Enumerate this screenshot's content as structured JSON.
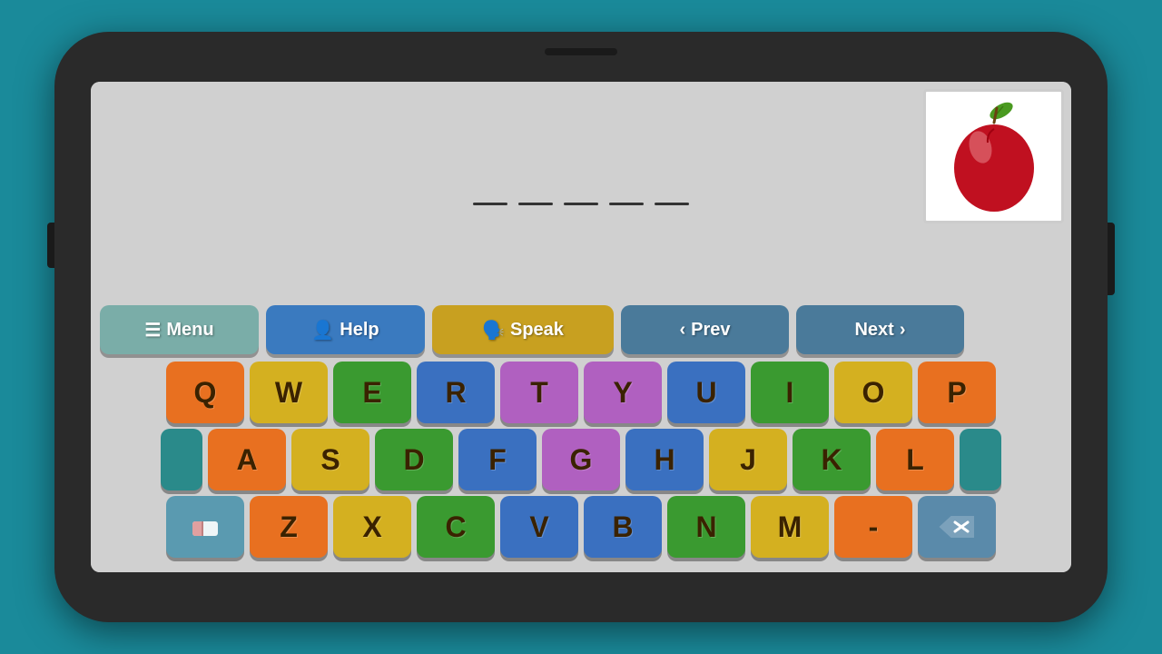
{
  "phone": {
    "background": "#1a8a9a"
  },
  "nav": {
    "menu_label": "Menu",
    "help_label": "Help",
    "speak_label": "Speak",
    "prev_label": "Prev",
    "next_label": "Next",
    "menu_icon": "☰",
    "help_icon": "👤",
    "speak_icon": "🗣️",
    "prev_arrow": "‹",
    "next_arrow": "›"
  },
  "word_blanks": {
    "count": 5
  },
  "keyboard": {
    "row1": [
      "Q",
      "W",
      "E",
      "R",
      "T",
      "Y",
      "U",
      "I",
      "O",
      "P"
    ],
    "row2": [
      "A",
      "S",
      "D",
      "F",
      "G",
      "H",
      "J",
      "K",
      "L"
    ],
    "row3": [
      "Z",
      "X",
      "C",
      "V",
      "B",
      "N",
      "M",
      "-"
    ],
    "row1_colors": [
      "orange",
      "yellow",
      "green",
      "blue",
      "purple",
      "purple",
      "blue",
      "green",
      "yellow",
      "orange"
    ],
    "row2_colors": [
      "orange",
      "yellow",
      "green",
      "blue",
      "purple",
      "blue",
      "yellow",
      "green",
      "orange"
    ],
    "row3_colors": [
      "orange",
      "yellow",
      "green",
      "blue",
      "blue",
      "green",
      "yellow",
      "orange"
    ]
  },
  "apple": {
    "alt": "Apple"
  }
}
